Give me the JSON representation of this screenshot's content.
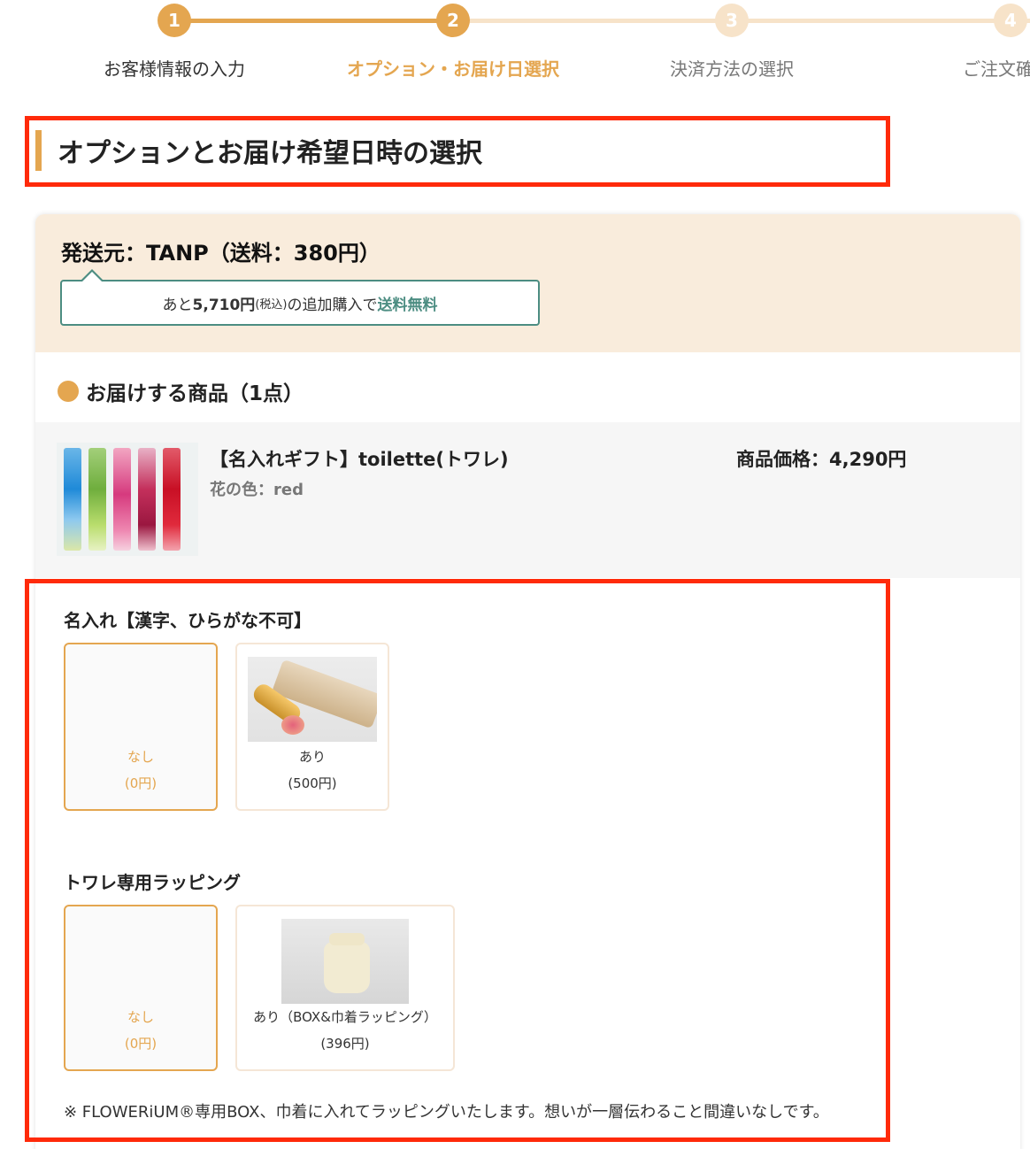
{
  "stepper": {
    "steps": [
      {
        "number": "1",
        "label": "お客様情報の入力",
        "state": "done"
      },
      {
        "number": "2",
        "label": "オプション・お届け日選択",
        "state": "active"
      },
      {
        "number": "3",
        "label": "決済方法の選択",
        "state": "todo"
      },
      {
        "number": "4",
        "label": "ご注文確",
        "state": "todo"
      }
    ],
    "colors": {
      "active": "#e4a650",
      "inactive": "#f7e3c9"
    }
  },
  "section": {
    "title": "オプションとお届け希望日時の選択"
  },
  "shipping": {
    "title": "発送元：TANP（送料：380円）",
    "bubble": {
      "prefix": "あと",
      "amount": "5,710円",
      "tax": "(税込)",
      "middle": "の追加購入で",
      "free": "送料無料"
    }
  },
  "items": {
    "title": "お届けする商品（1点）",
    "product": {
      "name": "【名入れギフト】toilette(トワレ)",
      "variant": "花の色：red",
      "price": "商品価格：4,290円",
      "image_icon": "flower-bottles-photo"
    }
  },
  "options": {
    "engraving": {
      "title": "名入れ【漢字、ひらがな不可】",
      "choices": [
        {
          "label": "なし",
          "price": "(0円)",
          "selected": true
        },
        {
          "label": "あり",
          "price": "(500円)",
          "selected": false,
          "image_icon": "engraved-lipstick-photo"
        }
      ]
    },
    "wrapping": {
      "title": "トワレ専用ラッピング",
      "choices": [
        {
          "label": "なし",
          "price": "(0円)",
          "selected": true
        },
        {
          "label": "あり（BOX&巾着ラッピング）",
          "price": "(396円)",
          "selected": false,
          "image_icon": "drawstring-bag-photo"
        }
      ]
    },
    "note": "※ FLOWERiUM®専用BOX、巾着に入れてラッピングいたします。想いが一層伝わること間違いなしです。"
  },
  "colors": {
    "accent": "#e4a650",
    "highlight": "#ff2a0a",
    "teal": "#4c8d82",
    "header_bg": "#f9ecdc"
  }
}
